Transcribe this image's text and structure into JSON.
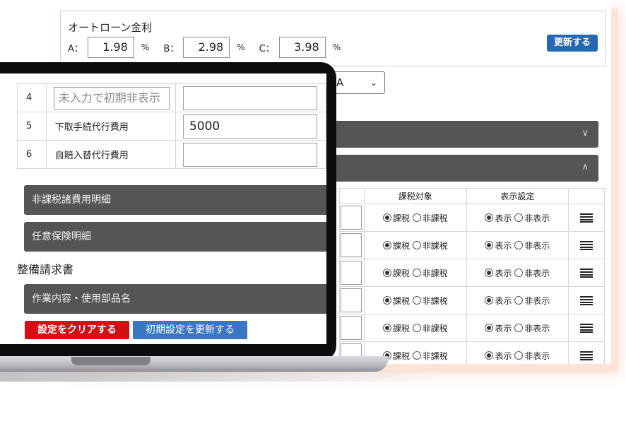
{
  "auto_loan": {
    "title": "オートローン金利",
    "rates": [
      {
        "key": "A：",
        "value": "1.98",
        "unit": "%"
      },
      {
        "key": "B：",
        "value": "2.98",
        "unit": "%"
      },
      {
        "key": "C：",
        "value": "3.98",
        "unit": "%"
      }
    ],
    "update_label": "更新する"
  },
  "select": {
    "value": "A",
    "chevron": "⌄"
  },
  "bg_sections": [
    {
      "arrow": "∨"
    },
    {
      "arrow": "∧"
    }
  ],
  "tax_table": {
    "headers": [
      "課税対象",
      "表示設定"
    ],
    "tax_on": "課税",
    "tax_off": "非課税",
    "show_on": "表示",
    "show_off": "非表示",
    "rows": 6
  },
  "laptop": {
    "cost_rows": [
      {
        "num": "4",
        "label": "未入力で初期非表示",
        "label_is_placeholder": true,
        "value": ""
      },
      {
        "num": "5",
        "label": "下取手続代行費用",
        "label_is_placeholder": false,
        "value": "5000"
      },
      {
        "num": "6",
        "label": "自賠入替代行費用",
        "label_is_placeholder": false,
        "value": ""
      }
    ],
    "bar_nontax": "非課税諸費用明細",
    "bar_insurance": "任意保険明細",
    "heading_invoice": "整備請求書",
    "bar_work": "作業内容・使用部品名",
    "clear_button": "設定をクリアする",
    "reset_button": "初期設定を更新する"
  }
}
